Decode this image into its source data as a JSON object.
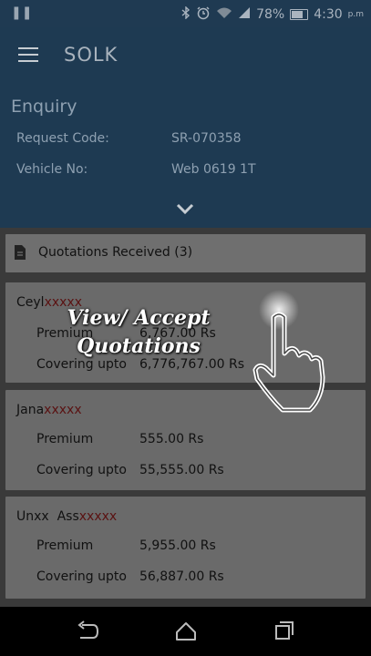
{
  "status_bar": {
    "battery": "78%",
    "time": "4:30",
    "ampm": "p.m",
    "icons": [
      "pause-icon",
      "bluetooth-icon",
      "alarm-icon",
      "wifi-icon",
      "signal-icon",
      "battery-icon"
    ]
  },
  "app_bar": {
    "title": "SOLK"
  },
  "enquiry": {
    "heading": "Enquiry",
    "request_code_label": "Request Code:",
    "request_code_value": "SR-070358",
    "vehicle_no_label": "Vehicle No:",
    "vehicle_no_value": "Web 0619 1T"
  },
  "quotations": {
    "header": "Quotations Received (3)",
    "items": [
      {
        "company_prefix": "Ceyl",
        "company_mask": "xxxxx",
        "premium_label": "Premium",
        "premium_value": "6,767.00 Rs",
        "cover_label": "Covering upto",
        "cover_value": "6,776,767.00 Rs"
      },
      {
        "company_prefix": "Jana",
        "company_mask": "xxxxx",
        "premium_label": "Premium",
        "premium_value": "555.00 Rs",
        "cover_label": "Covering upto",
        "cover_value": "55,555.00 Rs"
      },
      {
        "company_prefix": "Unxx  Ass",
        "company_mask": "xxxxx",
        "premium_label": "Premium",
        "premium_value": "5,955.00 Rs",
        "cover_label": "Covering upto",
        "cover_value": "56,887.00 Rs"
      }
    ]
  },
  "overlay": {
    "line1": "View/ Accept",
    "line2": "Quotations"
  },
  "colors": {
    "appbar": "#1e3a52",
    "card": "#6a6a6a",
    "overlay_text": "#ffffff"
  }
}
